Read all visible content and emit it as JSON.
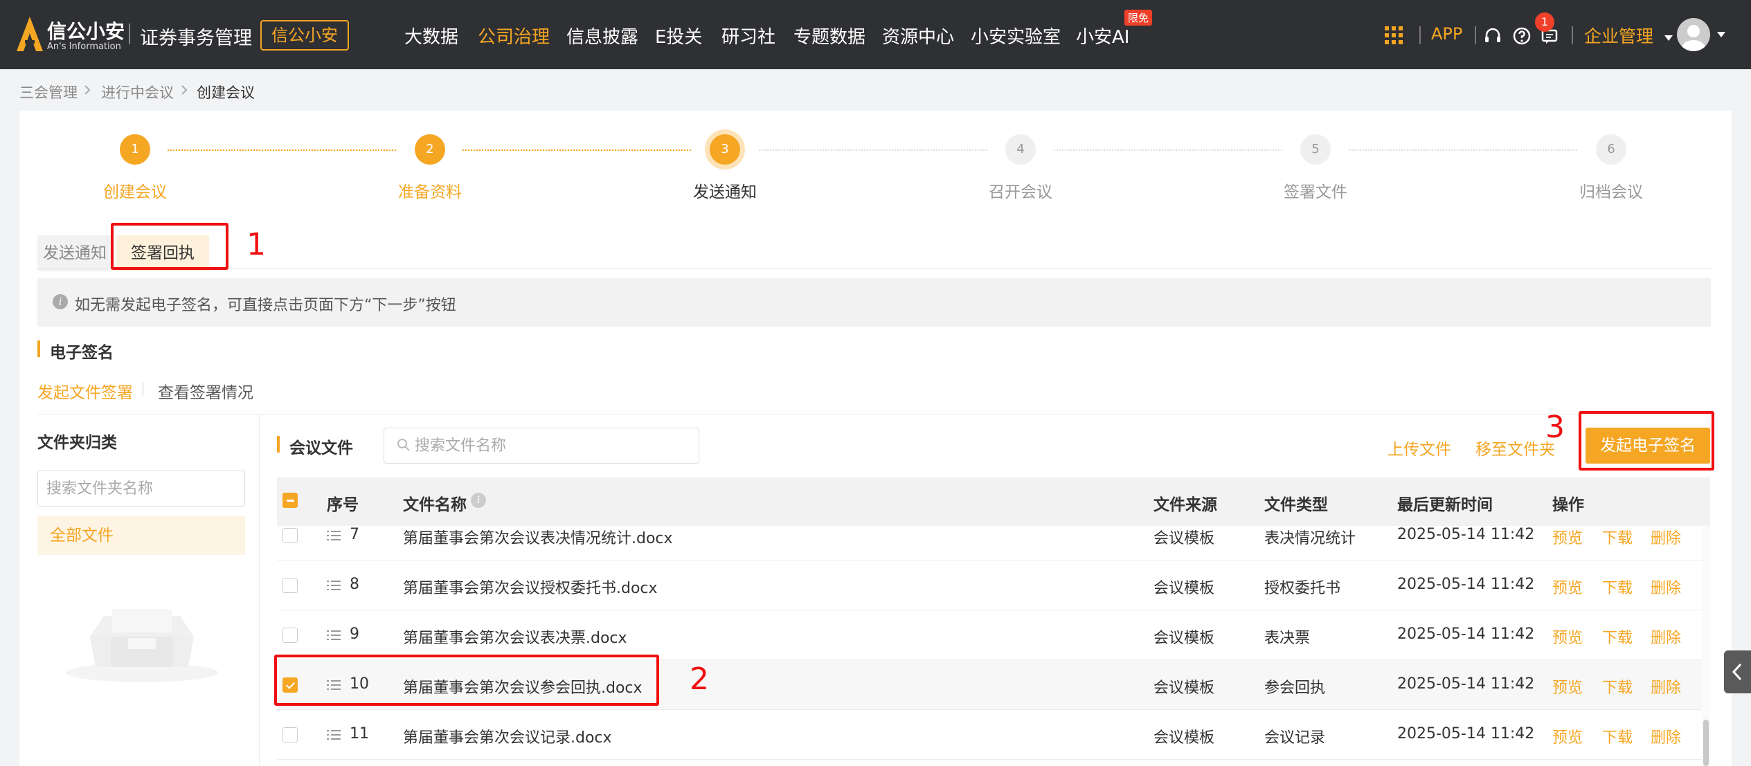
{
  "topnav": {
    "logo_name": "信公小安",
    "logo_sub": "An's Information",
    "app_title": "证券事务管理",
    "brand_button": "信公小安",
    "nav_items": [
      "大数据",
      "公司治理",
      "信息披露",
      "E投关",
      "研习社",
      "专题数据",
      "资源中心",
      "小安实验室",
      "小安AI"
    ],
    "nav_badge": "限免",
    "app_link": "APP",
    "notification_count": "1",
    "enterprise_menu": "企业管理"
  },
  "breadcrumb": [
    "三会管理",
    "进行中会议",
    "创建会议"
  ],
  "steps": [
    {
      "num": "1",
      "label": "创建会议",
      "state": "done"
    },
    {
      "num": "2",
      "label": "准备资料",
      "state": "done"
    },
    {
      "num": "3",
      "label": "发送通知",
      "state": "current"
    },
    {
      "num": "4",
      "label": "召开会议",
      "state": "todo"
    },
    {
      "num": "5",
      "label": "签署文件",
      "state": "todo"
    },
    {
      "num": "6",
      "label": "归档会议",
      "state": "todo"
    }
  ],
  "tabs": {
    "send": "发送通知",
    "sign": "签署回执"
  },
  "info": {
    "icon": "i",
    "text": "如无需发起电子签名，可直接点击页面下方“下一步”按钮"
  },
  "esign": {
    "title": "电子签名",
    "sublink_start": "发起文件签署",
    "sublink_view": "查看签署情况"
  },
  "folder": {
    "title": "文件夹归类",
    "search_placeholder": "搜索文件夹名称",
    "all_files": "全部文件"
  },
  "files": {
    "title": "会议文件",
    "search_placeholder": "搜索文件名称",
    "upload": "上传文件",
    "move": "移至文件夹",
    "start_esign": "发起电子签名",
    "columns": {
      "seq": "序号",
      "name": "文件名称",
      "source": "文件来源",
      "type": "文件类型",
      "updated": "最后更新时间",
      "ops": "操作"
    },
    "help": "i",
    "op_labels": {
      "preview": "预览",
      "download": "下载",
      "delete": "删除"
    },
    "rows": [
      {
        "seq": "7",
        "name": "第届董事会第次会议表决情况统计.docx",
        "source": "会议模板",
        "type": "表决情况统计",
        "updated": "2025-05-14 11:42",
        "checked": false
      },
      {
        "seq": "8",
        "name": "第届董事会第次会议授权委托书.docx",
        "source": "会议模板",
        "type": "授权委托书",
        "updated": "2025-05-14 11:42",
        "checked": false
      },
      {
        "seq": "9",
        "name": "第届董事会第次会议表决票.docx",
        "source": "会议模板",
        "type": "表决票",
        "updated": "2025-05-14 11:42",
        "checked": false
      },
      {
        "seq": "10",
        "name": "第届董事会第次会议参会回执.docx",
        "source": "会议模板",
        "type": "参会回执",
        "updated": "2025-05-14 11:42",
        "checked": true
      },
      {
        "seq": "11",
        "name": "第届董事会第次会议记录.docx",
        "source": "会议模板",
        "type": "会议记录",
        "updated": "2025-05-14 11:42",
        "checked": false
      }
    ]
  },
  "annotations": [
    "1",
    "2",
    "3"
  ],
  "colors": {
    "accent": "#f5a623",
    "nav_bg": "#2f3033",
    "annotation": "#f00f0f",
    "badge": "#f0402a"
  },
  "icons": [
    "logo-icon",
    "apps-grid-icon",
    "headset-icon",
    "help-icon",
    "message-icon",
    "caret-down-icon",
    "avatar-icon",
    "chevron-right-icon",
    "info-icon",
    "search-icon",
    "drag-handle-icon",
    "empty-box-icon",
    "chevron-left-icon"
  ]
}
